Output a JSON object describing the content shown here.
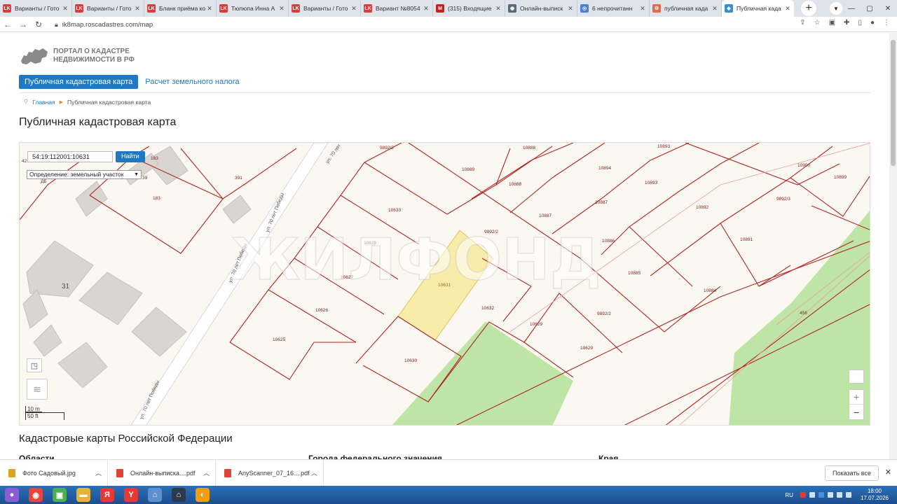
{
  "tabs": [
    {
      "title": "Варианты / Гото",
      "fav": "LK",
      "color": "#d93d3d"
    },
    {
      "title": "Варианты / Гото",
      "fav": "LK",
      "color": "#d93d3d"
    },
    {
      "title": "Бланк приёма ко",
      "fav": "LK",
      "color": "#d93d3d"
    },
    {
      "title": "Тюлюпа Инна А",
      "fav": "LK",
      "color": "#d93d3d"
    },
    {
      "title": "Варианты / Гото",
      "fav": "LK",
      "color": "#d93d3d"
    },
    {
      "title": "Вариант №8054",
      "fav": "LK",
      "color": "#d93d3d"
    },
    {
      "title": "(315) Входящие",
      "fav": "M",
      "color": "#c5221f"
    },
    {
      "title": "Онлайн-выписк",
      "fav": "◉",
      "color": "#5a6a7a"
    },
    {
      "title": "6 непрочитанн",
      "fav": "◎",
      "color": "#4a7fd4"
    },
    {
      "title": "публичная када",
      "fav": "⚙",
      "color": "#e06b4a"
    },
    {
      "title": "Публичная када",
      "fav": "◆",
      "color": "#3b8fd0",
      "active": true
    }
  ],
  "address": {
    "url": "ik8map.roscadastres.com/map"
  },
  "site": {
    "logo_line1": "ПОРТАЛ О КАДАСТРЕ",
    "logo_line2": "НЕДВИЖИМОСТИ В РФ",
    "nav_active": "Публичная кадастровая карта",
    "nav_link": "Расчет земельного налога",
    "crumb_home": "Главная",
    "crumb_current": "Публичная кадастровая карта",
    "page_title": "Публичная кадастровая карта",
    "section_title": "Кадастровые карты Российской Федерации",
    "columns": [
      "Области",
      "Города федерального значения",
      "Края"
    ]
  },
  "map": {
    "search_value": "54:19:112001:10631",
    "search_button": "Найти",
    "select_label": "Определение: земельный участок",
    "watermark": "ЖИЛФОНД",
    "scale_m": "10 m",
    "scale_ft": "50 ft",
    "zoom_in": "+",
    "zoom_out": "−",
    "selected_parcel": "10631",
    "building_number": "31",
    "street": "ул. 70 лет Победы",
    "street_short": "ул. 70 лет",
    "parcel_labels": [
      "9892/2",
      "10888",
      "10893",
      "10889",
      "10894",
      "10900",
      "10899",
      "10888",
      "10893",
      "391",
      "183",
      "183",
      "10633",
      "10887",
      "10887",
      "10892",
      "9892/3",
      "9892/2",
      "10886",
      "10891",
      "10628",
      "10885",
      "10627",
      "10631",
      "10884",
      "10632",
      "9892/2",
      "456",
      "10626",
      "10629",
      "10629",
      "10625",
      "10630",
      "42",
      "ДЕ",
      "39"
    ]
  },
  "downloads": [
    {
      "name": "Фото Садовый.jpg",
      "color": "#d9a520"
    },
    {
      "name": "Онлайн-выписка....pdf",
      "color": "#e0453a"
    },
    {
      "name": "AnyScanner_07_16....pdf",
      "color": "#e0453a"
    }
  ],
  "downloads_show_all": "Показать все",
  "taskbar": {
    "lang": "RU",
    "time": "18:00",
    "date": "17.07.2026",
    "apps": [
      {
        "icon": "start-orb-icon",
        "glyph": "●",
        "color": "#8a5cd6"
      },
      {
        "icon": "chrome-icon",
        "glyph": "◉",
        "color": "#e8453c"
      },
      {
        "icon": "app-store-icon",
        "glyph": "▣",
        "color": "#4caf50"
      },
      {
        "icon": "folder-icon",
        "glyph": "▬",
        "color": "#e6b43a"
      },
      {
        "icon": "yandex-icon",
        "glyph": "Я",
        "color": "#e53935"
      },
      {
        "icon": "yandex-browser-icon",
        "glyph": "Y",
        "color": "#e53935"
      },
      {
        "icon": "home-app-icon",
        "glyph": "⌂",
        "color": "#5e8fd0"
      },
      {
        "icon": "house-icon",
        "glyph": "⌂",
        "color": "#2d3a4a"
      },
      {
        "icon": "orange-app-icon",
        "glyph": "◐",
        "color": "#f39c12"
      }
    ]
  }
}
